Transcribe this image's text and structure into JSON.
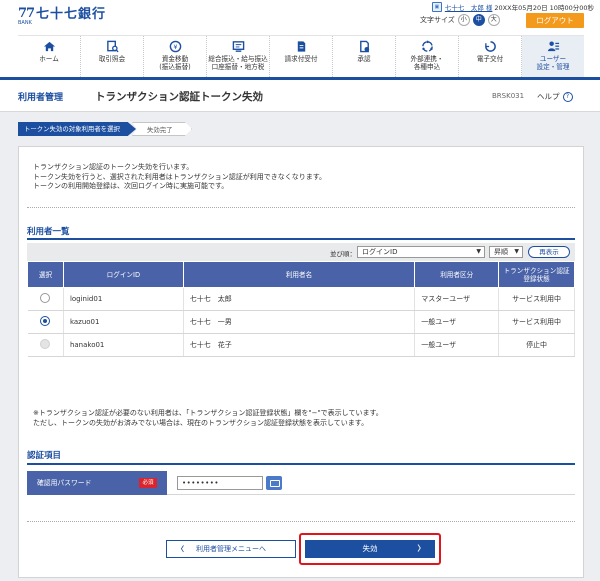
{
  "header": {
    "bank_mark": "77",
    "bank_mark_sub": "BANK",
    "bank_name": "七十七銀行",
    "user_name": "七十七　太郎 様",
    "login_time": "20XX年05月20日 10時00分00秒",
    "font_size_label": "文字サイズ",
    "font_sizes": [
      "小",
      "中",
      "大"
    ],
    "logout_label": "ログアウト"
  },
  "nav": {
    "items": [
      {
        "label": "ホーム",
        "icon": "home-icon"
      },
      {
        "label": "取引照会",
        "icon": "search-doc-icon"
      },
      {
        "label": "資金移動\n(振込振替)",
        "icon": "transfer-icon"
      },
      {
        "label": "総合振込・給与振込\n口座振替・地方税",
        "icon": "batch-transfer-icon"
      },
      {
        "label": "請求付受付",
        "icon": "invoice-icon"
      },
      {
        "label": "承認",
        "icon": "approve-icon"
      },
      {
        "label": "外部連携・\n各種申込",
        "icon": "link-icon"
      },
      {
        "label": "電子交付",
        "icon": "e-delivery-icon"
      },
      {
        "label": "ユーザー\n設定・管理",
        "icon": "user-settings-icon"
      }
    ]
  },
  "page": {
    "category": "利用者管理",
    "title": "トランザクション認証トークン失効",
    "screen_id": "BRSK031",
    "help_label": "ヘルプ",
    "help_icon": "?"
  },
  "steps": [
    "トークン失効の対象利用者を選択",
    "失効完了"
  ],
  "intro": [
    "トランザクション認証のトークン失効を行います。",
    "トークン失効を行うと、選択された利用者はトランザクション認証が利用できなくなります。",
    "トークンの利用開始登録は、次回ログイン時に実施可能です。"
  ],
  "user_list": {
    "title": "利用者一覧",
    "sort_label": "並び順：",
    "sort_value": "ログインID",
    "order_value": "昇順",
    "redisplay_label": "再表示",
    "columns": [
      "選択",
      "ログインID",
      "利用者名",
      "利用者区分",
      "トランザクション認証\n登録状態"
    ],
    "rows": [
      {
        "login_id": "loginid01",
        "name": "七十七　太郎",
        "type": "マスターユーザ",
        "status": "サービス利用中",
        "selected": false,
        "disabled": false
      },
      {
        "login_id": "kazuo01",
        "name": "七十七　一男",
        "type": "一般ユーザ",
        "status": "サービス利用中",
        "selected": true,
        "disabled": false
      },
      {
        "login_id": "hanako01",
        "name": "七十七　花子",
        "type": "一般ユーザ",
        "status": "停止中",
        "selected": false,
        "disabled": true
      }
    ],
    "notes": [
      "※トランザクション認証が必要のない利用者は、「トランザクション認証登録状態」欄を\"−\"で表示しています。",
      "ただし、トークンの失効がお済みでない場合は、現在のトランザクション認証登録状態を表示しています。"
    ]
  },
  "auth": {
    "title": "認証項目",
    "password_label": "確認用パスワード",
    "required_label": "必須",
    "password_value": "••••••••"
  },
  "buttons": {
    "back_label": "利用者管理メニューへ",
    "back_chevron": "〈",
    "submit_label": "失効",
    "submit_chevron": "〉"
  },
  "colors": {
    "primary": "#1d4fa1",
    "table_header": "#4a63a8",
    "logout": "#f39a1c",
    "required": "#d9262e",
    "highlight_border": "#e0141b"
  }
}
